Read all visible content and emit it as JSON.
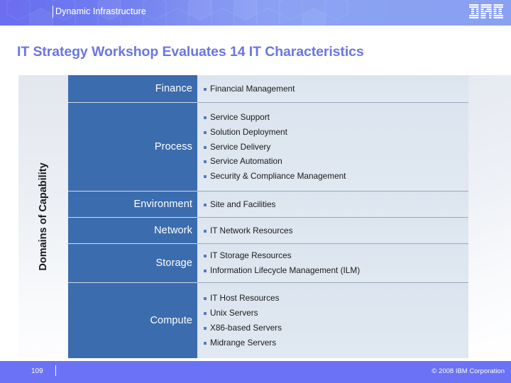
{
  "header": {
    "eyebrow": "Dynamic Infrastructure",
    "logo": "ibm-logo"
  },
  "title": "IT Strategy Workshop Evaluates 14 IT Characteristics",
  "table": {
    "axis_label": "Domains of Capability",
    "rows": [
      {
        "category": "Finance",
        "items": [
          "Financial Management"
        ]
      },
      {
        "category": "Process",
        "items": [
          "Service Support",
          "Solution Deployment",
          "Service Delivery",
          "Service Automation",
          "Security & Compliance Management"
        ]
      },
      {
        "category": "Environment",
        "items": [
          "Site and Facilities"
        ]
      },
      {
        "category": "Network",
        "items": [
          "IT Network Resources"
        ]
      },
      {
        "category": "Storage",
        "items": [
          "IT Storage Resources",
          "Information Lifecycle Management (ILM)"
        ]
      },
      {
        "category": "Compute",
        "items": [
          "IT Host Resources",
          "Unix Servers",
          "X86-based Servers",
          "Midrange Servers"
        ]
      }
    ]
  },
  "footer": {
    "page_number": "109",
    "copyright": "© 2008 IBM Corporation"
  },
  "colors": {
    "header_start": "#6d6ef0",
    "header_end": "#8aa0f1",
    "title": "#6b76e2",
    "category_cell": "#3b6cae",
    "items_cell": "#dce5ef",
    "footer": "#6b72f5",
    "bullet": "#5b78b5"
  }
}
